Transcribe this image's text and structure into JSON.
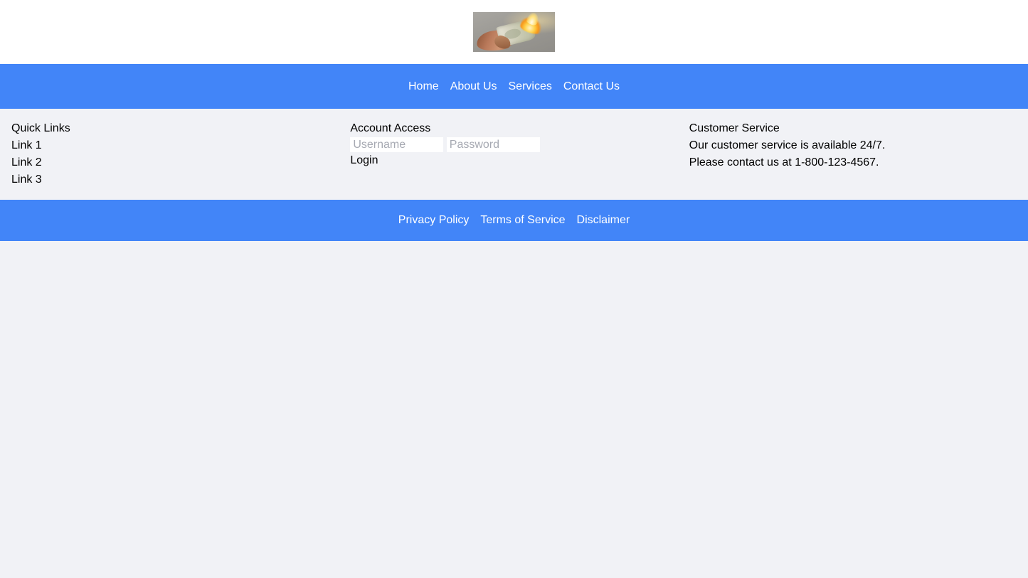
{
  "theme": {
    "accent": "#4285f8",
    "page_background": "#f1f2f6",
    "header_background": "#ffffff",
    "text": "#000000",
    "nav_text": "#ffffff",
    "placeholder_text": "#a6a9b2",
    "input_background": "#ffffff"
  },
  "header": {
    "logo_icon": "burning-money-logo-image",
    "logo_alt": "Hand holding burning money"
  },
  "nav": {
    "items": [
      {
        "label": "Home"
      },
      {
        "label": "About Us"
      },
      {
        "label": "Services"
      },
      {
        "label": "Contact Us"
      }
    ]
  },
  "main": {
    "quick_links": {
      "title": "Quick Links",
      "links": [
        {
          "label": "Link 1"
        },
        {
          "label": "Link 2"
        },
        {
          "label": "Link 3"
        }
      ]
    },
    "account_access": {
      "title": "Account Access",
      "username": {
        "value": "",
        "placeholder": "Username"
      },
      "password": {
        "value": "",
        "placeholder": "Password"
      },
      "submit_label": "Login"
    },
    "customer_service": {
      "title": "Customer Service",
      "lines": [
        "Our customer service is available 24/7.",
        "Please contact us at 1-800-123-4567."
      ]
    }
  },
  "footer": {
    "items": [
      {
        "label": "Privacy Policy"
      },
      {
        "label": "Terms of Service"
      },
      {
        "label": "Disclaimer"
      }
    ]
  }
}
